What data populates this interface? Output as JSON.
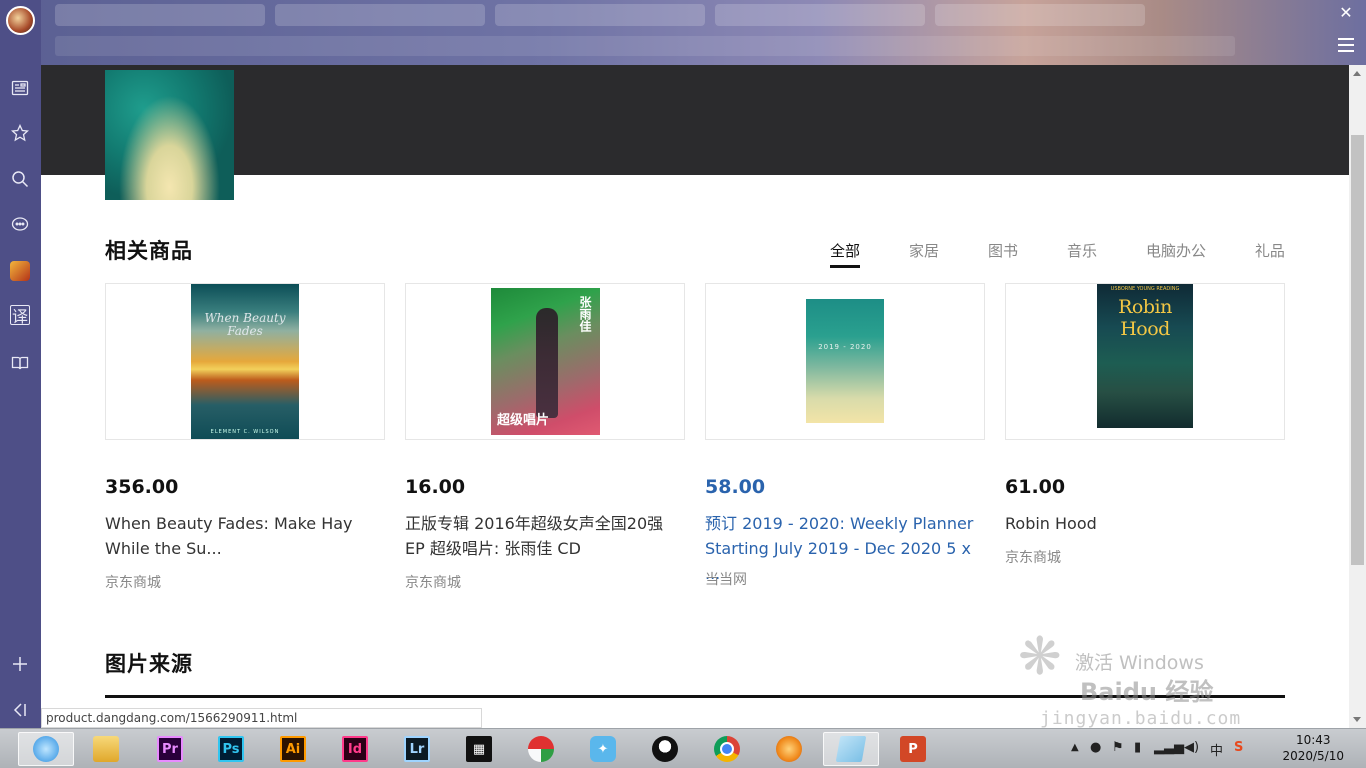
{
  "browser": {
    "status_url": "product.dangdang.com/1566290911.html",
    "close_glyph": "✕"
  },
  "sidebar": {
    "icons": [
      "news-icon",
      "star-icon",
      "search-icon",
      "chat-icon",
      "game-icon",
      "translate-icon",
      "book-icon",
      "plus-icon",
      "collapse-icon"
    ],
    "translate_glyph": "译"
  },
  "related": {
    "title": "相关商品",
    "filters": [
      "全部",
      "家居",
      "图书",
      "音乐",
      "电脑办公",
      "礼品"
    ],
    "active_filter": 0,
    "products": [
      {
        "price": "356.00",
        "name_line1": "When Beauty Fades: Make Hay",
        "name_line2": "While the Su...",
        "store": "京东商城",
        "cover_title": "When Beauty Fades",
        "cover_author": "ELEMENT C. WILSON"
      },
      {
        "price": "16.00",
        "name_line1": "正版专辑 2016年超级女声全国20强",
        "name_line2": "EP 超级唱片: 张雨佳 CD",
        "store": "京东商城",
        "cover_name": "张雨佳",
        "cover_mark": "超级唱片"
      },
      {
        "price": "58.00",
        "name_line1": "预订 2019 - 2020: Weekly Planner",
        "name_line2": "Starting July 2019 - Dec 2020 5 x ...",
        "store": "当当网",
        "cover_year": "2019 - 2020",
        "highlight_color": "#2a63ad"
      },
      {
        "price": "61.00",
        "name_line1": "Robin Hood",
        "name_line2": "",
        "store": "京东商城",
        "cover_title": "Robin Hood",
        "cover_top": "USBORNE YOUNG READING"
      }
    ]
  },
  "sources": {
    "title": "图片来源"
  },
  "watermark": {
    "line1": "激活 Windows",
    "line2": "jingyan.baidu.com",
    "logo": "Baidu 经验"
  },
  "taskbar": {
    "apps": [
      "ie-browser",
      "file-explorer",
      "premiere",
      "photoshop",
      "illustrator",
      "indesign",
      "lightroom",
      "video-editor",
      "umbrella-app",
      "bird-app",
      "qq",
      "chrome",
      "firefox-like",
      "notepad",
      "powerpoint"
    ],
    "app_labels": {
      "pr": "Pr",
      "ps": "Ps",
      "ai": "Ai",
      "id": "Id",
      "lr": "Lr",
      "ppt": "P"
    },
    "ime": "中",
    "time": "10:43",
    "date": "2020/5/10"
  }
}
